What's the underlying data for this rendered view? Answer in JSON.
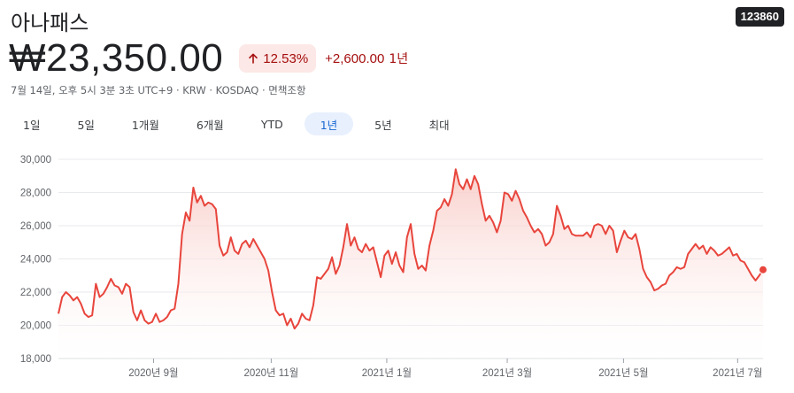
{
  "stock": {
    "name": "아나패스",
    "ticker": "123860",
    "price": "₩23,350.00",
    "change_percent": "12.53%",
    "change_abs": "+2,600.00",
    "change_period": "1년",
    "meta": "7월 14일, 오후 5시 3분 3초 UTC+9 · KRW · KOSDAQ · 면책조항"
  },
  "tabs": [
    {
      "label": "1일"
    },
    {
      "label": "5일"
    },
    {
      "label": "1개월"
    },
    {
      "label": "6개월"
    },
    {
      "label": "YTD"
    },
    {
      "label": "1년",
      "active": true
    },
    {
      "label": "5년"
    },
    {
      "label": "최대"
    }
  ],
  "colors": {
    "line": "#e8453c",
    "fill_top": "#f8c9c4",
    "grid": "#e8eaed",
    "negative": "#a50e0e",
    "negative_bg": "#fce8e6",
    "active_tab_bg": "#e8f0fe",
    "active_tab_text": "#1967d2"
  },
  "chart_data": {
    "type": "area",
    "y_ticks": [
      "30,000",
      "28,000",
      "26,000",
      "24,000",
      "22,000",
      "20,000",
      "18,000"
    ],
    "x_ticks": [
      "2020년 9월",
      "2020년 11월",
      "2021년 1월",
      "2021년 3월",
      "2021년 5월",
      "2021년 7월"
    ],
    "ylim": [
      18000,
      30000
    ],
    "x": [
      "2020-07-14",
      "2021-07-14"
    ],
    "series": [
      {
        "values": [
          20700,
          21700,
          22000,
          21800,
          21500,
          21700,
          21300,
          20700,
          20500,
          20600,
          22500,
          21700,
          21900,
          22300,
          22800,
          22400,
          22300,
          21900,
          22500,
          22300,
          20800,
          20300,
          20900,
          20300,
          20100,
          20200,
          20700,
          20200,
          20300,
          20500,
          20900,
          21000,
          22500,
          25500,
          26800,
          26300,
          28300,
          27400,
          27800,
          27200,
          27400,
          27300,
          27000,
          24800,
          24200,
          24400,
          25300,
          24500,
          24300,
          24900,
          25100,
          24700,
          25200,
          24800,
          24400,
          24000,
          23300,
          22000,
          20900,
          20600,
          20700,
          20000,
          20400,
          19800,
          20100,
          20700,
          20400,
          20300,
          21200,
          22900,
          22800,
          23100,
          23400,
          24100,
          23100,
          23600,
          24700,
          26100,
          24800,
          25300,
          24600,
          24400,
          24900,
          24500,
          24700,
          23800,
          22900,
          24200,
          24500,
          23700,
          24400,
          23600,
          23200,
          25300,
          26100,
          24300,
          23400,
          23600,
          23300,
          24800,
          25700,
          26900,
          27100,
          27600,
          27200,
          27900,
          29400,
          28500,
          28200,
          28800,
          28200,
          29000,
          28500,
          27300,
          26300,
          26600,
          26200,
          25600,
          26300,
          28000,
          27900,
          27500,
          28100,
          27600,
          26900,
          26500,
          26000,
          25600,
          25800,
          25500,
          24800,
          25000,
          25500,
          27200,
          26600,
          25800,
          26000,
          25500,
          25400,
          25400,
          25400,
          25600,
          25300,
          26000,
          26100,
          26000,
          25500,
          26000,
          25700,
          24400,
          25100,
          25700,
          25300,
          25200,
          25500,
          24600,
          23400,
          22900,
          22600,
          22100,
          22200,
          22400,
          22500,
          23000,
          23200,
          23500,
          23400,
          23500,
          24300,
          24600,
          24900,
          24600,
          24800,
          24300,
          24700,
          24500,
          24200,
          24300,
          24500,
          24700,
          24200,
          24300,
          23900,
          23800,
          23400,
          23000,
          22700,
          23000,
          23350
        ]
      }
    ]
  }
}
